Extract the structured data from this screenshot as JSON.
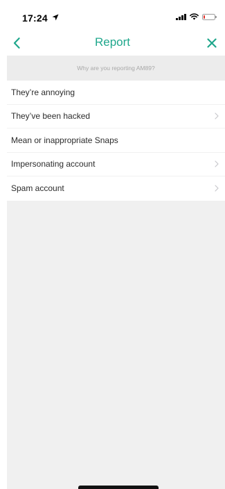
{
  "status_bar": {
    "time": "17:24",
    "location_icon": "location-arrow-icon",
    "signal_icon": "cellular-signal-icon",
    "wifi_icon": "wifi-icon",
    "battery_icon": "battery-low-icon",
    "battery_level_fraction": 0.15,
    "battery_color": "#e0312a"
  },
  "nav": {
    "title": "Report",
    "back_icon": "chevron-left-icon",
    "close_icon": "close-icon",
    "accent_color": "#1fa78c"
  },
  "section": {
    "header": "Why are you reporting AM89?"
  },
  "options": [
    {
      "label": "They’re annoying",
      "has_chevron": false
    },
    {
      "label": "They’ve been hacked",
      "has_chevron": true
    },
    {
      "label": "Mean or inappropriate Snaps",
      "has_chevron": false
    },
    {
      "label": "Impersonating account",
      "has_chevron": true
    },
    {
      "label": "Spam account",
      "has_chevron": true
    }
  ]
}
